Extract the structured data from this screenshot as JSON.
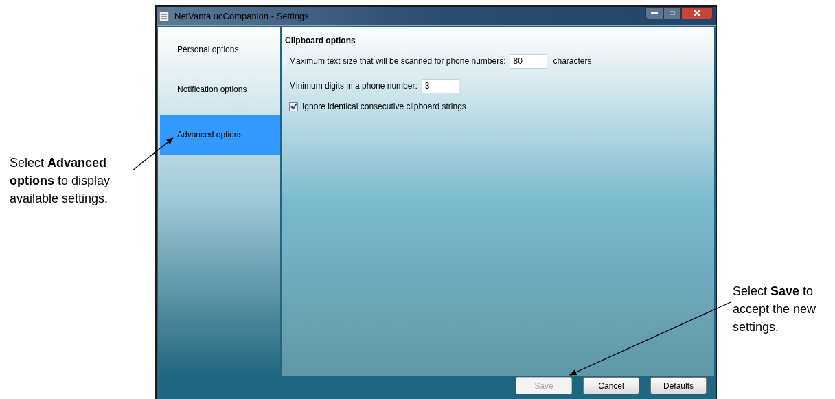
{
  "window": {
    "title": "NetVanta ucCompanion  - Settings"
  },
  "sidebar": {
    "items": [
      {
        "label": "Personal options",
        "selected": false
      },
      {
        "label": "Notification options",
        "selected": false
      },
      {
        "label": "Advanced options",
        "selected": true
      }
    ]
  },
  "section": {
    "title": "Clipboard options",
    "settings": [
      {
        "kind": "number",
        "label": "Maximum text size that will be scanned for phone numbers:",
        "value": "80",
        "suffix": "characters"
      },
      {
        "kind": "number",
        "label": "Minimum digits in a phone number:",
        "value": "3"
      },
      {
        "kind": "checkbox",
        "label": "Ignore identical consecutive clipboard strings",
        "checked": true
      }
    ]
  },
  "buttons": [
    {
      "label": "Save",
      "disabled": true
    },
    {
      "label": "Cancel",
      "disabled": false
    },
    {
      "label": "Defaults",
      "disabled": false
    }
  ],
  "annotations": [
    {
      "text": "Select **Advanced options** to display available settings."
    },
    {
      "text": "Select **Save** to accept the new settings."
    }
  ]
}
